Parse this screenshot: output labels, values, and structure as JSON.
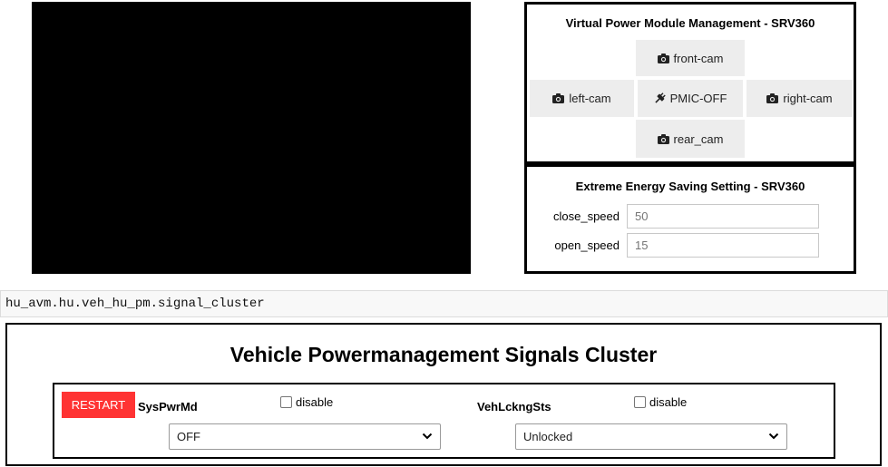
{
  "vpm": {
    "title": "Virtual Power Module Management - SRV360",
    "buttons": {
      "front": "front-cam",
      "left": "left-cam",
      "pmic": "PMIC-OFF",
      "right": "right-cam",
      "rear": "rear_cam"
    },
    "icons": {
      "camera": "camera-icon",
      "plug": "plug-icon"
    }
  },
  "ees": {
    "title": "Extreme Energy Saving Setting - SRV360",
    "close_speed": {
      "label": "close_speed",
      "value": "50"
    },
    "open_speed": {
      "label": "open_speed",
      "value": "15"
    }
  },
  "topic": "hu_avm.hu.veh_hu_pm.signal_cluster",
  "cluster": {
    "title": "Vehicle Powermanagement Signals Cluster",
    "restart_label": "RESTART",
    "signals": [
      {
        "name": "SysPwrMd",
        "disable_label": "disable",
        "selected": "OFF"
      },
      {
        "name": "VehLckngSts",
        "disable_label": "disable",
        "selected": "Unlocked"
      }
    ]
  },
  "colors": {
    "restart": "#ff3333",
    "button_bg": "#ededed",
    "video_bg": "#000000"
  }
}
